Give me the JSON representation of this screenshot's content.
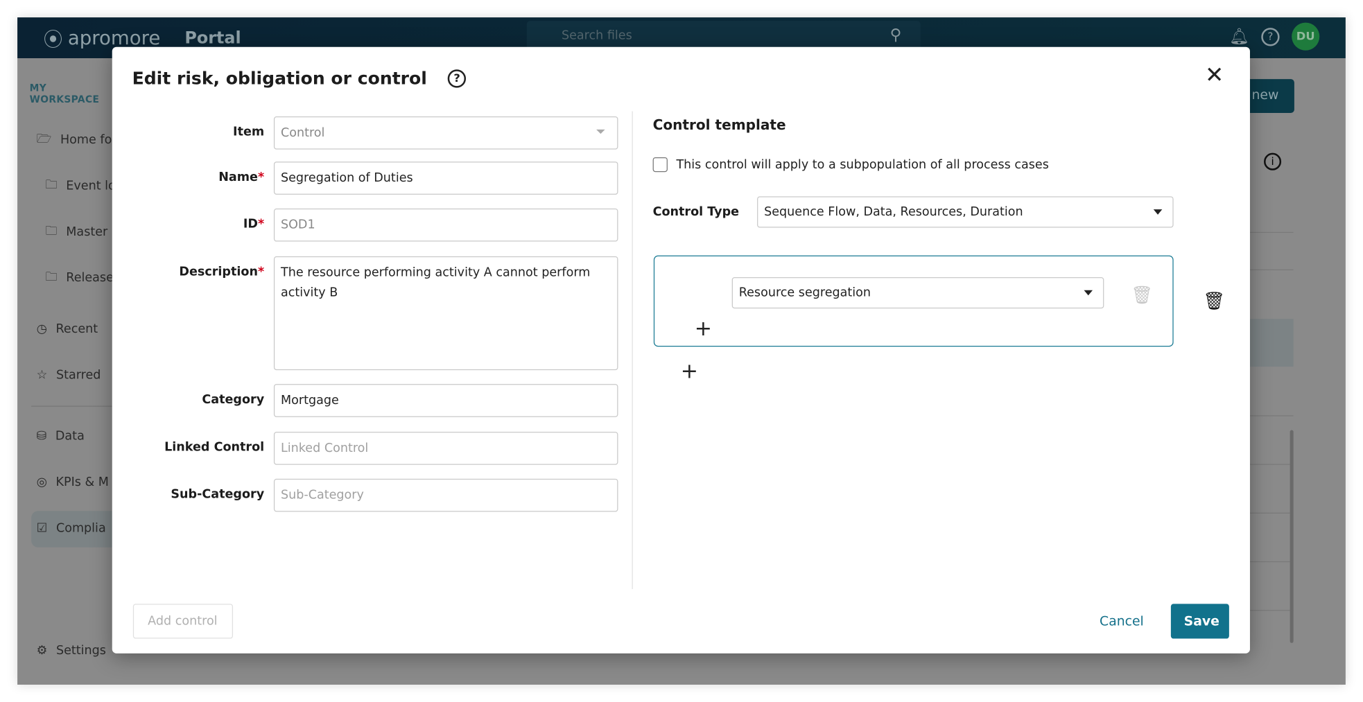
{
  "header": {
    "brand": "apromore",
    "product": "Portal",
    "search_placeholder": "Search files",
    "avatar_initials": "DU"
  },
  "sidebar": {
    "workspace_label": "MY WORKSPACE",
    "items": [
      {
        "label": "Home fo",
        "icon": "folder-open-icon"
      },
      {
        "label": "Event lo",
        "icon": "folder-icon"
      },
      {
        "label": "Master",
        "icon": "folder-icon"
      },
      {
        "label": "Release",
        "icon": "folder-icon"
      },
      {
        "label": "Recent",
        "icon": "clock-icon"
      },
      {
        "label": "Starred",
        "icon": "star-icon"
      },
      {
        "label": "Data",
        "icon": "database-icon"
      },
      {
        "label": "KPIs & M",
        "icon": "target-icon"
      },
      {
        "label": "Complia",
        "icon": "clipboard-check-icon",
        "selected": true
      },
      {
        "label": "Settings",
        "icon": "gear-icon"
      }
    ]
  },
  "background": {
    "new_button": "new"
  },
  "modal": {
    "title": "Edit risk, obligation or control",
    "fields": {
      "item": {
        "label": "Item",
        "value": "Control"
      },
      "name": {
        "label": "Name",
        "value": "Segregation of Duties",
        "required": true
      },
      "id": {
        "label": "ID",
        "value": "SOD1",
        "required": true
      },
      "description": {
        "label": "Description",
        "value": "The resource performing activity A cannot perform activity B",
        "required": true
      },
      "category": {
        "label": "Category",
        "value": "Mortgage"
      },
      "linked_control": {
        "label": "Linked Control",
        "placeholder": "Linked Control"
      },
      "sub_category": {
        "label": "Sub-Category",
        "placeholder": "Sub-Category"
      }
    },
    "required_mark": "*",
    "template": {
      "title": "Control template",
      "subpopulation_label": "This control will apply to a subpopulation of all process cases",
      "subpopulation_checked": false,
      "control_type_label": "Control Type",
      "control_type_value": "Sequence Flow, Data, Resources, Duration",
      "rule_value": "Resource segregation"
    },
    "add_control": "Add control",
    "cancel": "Cancel",
    "save": "Save",
    "accent_color": "#11728c"
  }
}
